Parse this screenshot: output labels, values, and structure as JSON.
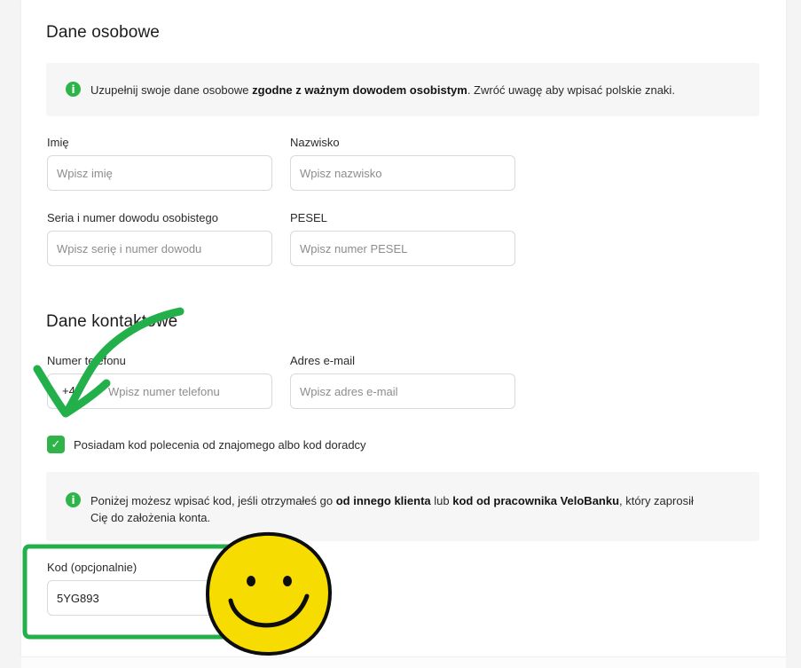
{
  "personal": {
    "title": "Dane osobowe",
    "info_plain1": "Uzupełnij swoje dane osobowe ",
    "info_bold1": "zgodne z ważnym dowodem osobistym",
    "info_plain2": ". Zwróć uwagę aby wpisać polskie znaki.",
    "first_name": {
      "label": "Imię",
      "placeholder": "Wpisz imię"
    },
    "last_name": {
      "label": "Nazwisko",
      "placeholder": "Wpisz nazwisko"
    },
    "id_card": {
      "label": "Seria i numer dowodu osobistego",
      "placeholder": "Wpisz serię i numer dowodu"
    },
    "pesel": {
      "label": "PESEL",
      "placeholder": "Wpisz numer PESEL"
    }
  },
  "contact": {
    "title": "Dane kontaktowe",
    "phone": {
      "label": "Numer telefonu",
      "prefix": "+48",
      "placeholder": "Wpisz numer telefonu"
    },
    "email": {
      "label": "Adres e-mail",
      "placeholder": "Wpisz adres e-mail"
    }
  },
  "referral": {
    "checkbox_label": "Posiadam kod polecenia od znajomego albo kod doradcy",
    "checked": true,
    "info_plain1": "Poniżej możesz wpisać kod, jeśli otrzymałeś go ",
    "info_bold1": "od innego klienta",
    "info_plain2": " lub ",
    "info_bold2": "kod od pracownika VeloBanku",
    "info_plain3": ", który zaprosił",
    "info_line2": "Cię do założenia konta.",
    "code": {
      "label": "Kod (opcjonalnie)",
      "value": "5YG893"
    }
  },
  "colors": {
    "accent_green": "#2fb44a",
    "annotation_green": "#23b04b",
    "smiley_yellow": "#f6dc00"
  },
  "icons": {
    "info": "info-circle-icon",
    "check": "checkmark-icon",
    "annotation_arrow": "curved-arrow-annotation",
    "annotation_smiley": "smiley-face-annotation"
  }
}
